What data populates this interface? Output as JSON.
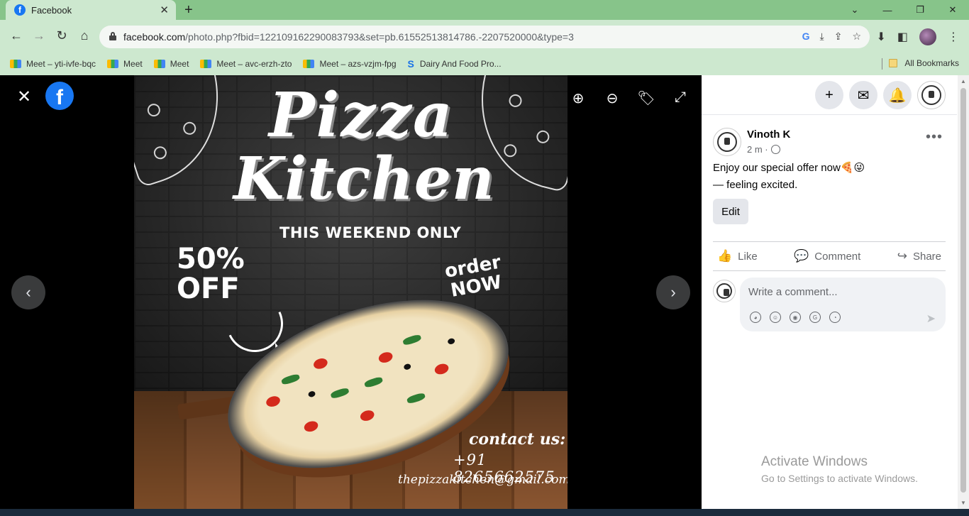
{
  "browser": {
    "tab_title": "Facebook",
    "new_tab": "+",
    "url_domain": "facebook.com",
    "url_rest": "/photo.php?fbid=122109162290083793&set=pb.61552513814786.-2207520000&type=3",
    "bookmarks": [
      {
        "label": "Meet – yti-ivfe-bqc",
        "icon": "meet-icon"
      },
      {
        "label": "Meet",
        "icon": "meet-icon"
      },
      {
        "label": "Meet",
        "icon": "meet-icon"
      },
      {
        "label": "Meet – avc-erzh-zto",
        "icon": "meet-icon"
      },
      {
        "label": "Meet – azs-vzjm-fpg",
        "icon": "meet-icon"
      },
      {
        "label": "Dairy And Food Pro...",
        "icon": "s-icon"
      }
    ],
    "all_bookmarks": "All Bookmarks"
  },
  "viewer": {
    "fb_logo": "f",
    "poster": {
      "title_line1": "Pizza",
      "title_line2": "Kitchen",
      "subtitle": "THIS WEEKEND ONLY",
      "offer_line1": "50%",
      "offer_line2": "OFF",
      "cta_line1": "order",
      "cta_line2": "NOW",
      "contact_heading": "contact us:",
      "contact_phone": "+91 8265662575",
      "contact_email": "thepizzakitchen@gmail.com"
    }
  },
  "post": {
    "author": "Vinoth K",
    "time": "2 m ·",
    "text": "Enjoy our special offer now🍕😜",
    "feeling": "— feeling excited.",
    "edit_label": "Edit",
    "more": "•••",
    "actions": {
      "like": "Like",
      "comment": "Comment",
      "share": "Share"
    },
    "comment_placeholder": "Write a comment..."
  },
  "watermark": {
    "line1": "Activate Windows",
    "line2": "Go to Settings to activate Windows."
  },
  "colors": {
    "facebook_blue": "#1877f2",
    "chrome_green": "#cde8cf",
    "tab_green": "#87c48a"
  }
}
